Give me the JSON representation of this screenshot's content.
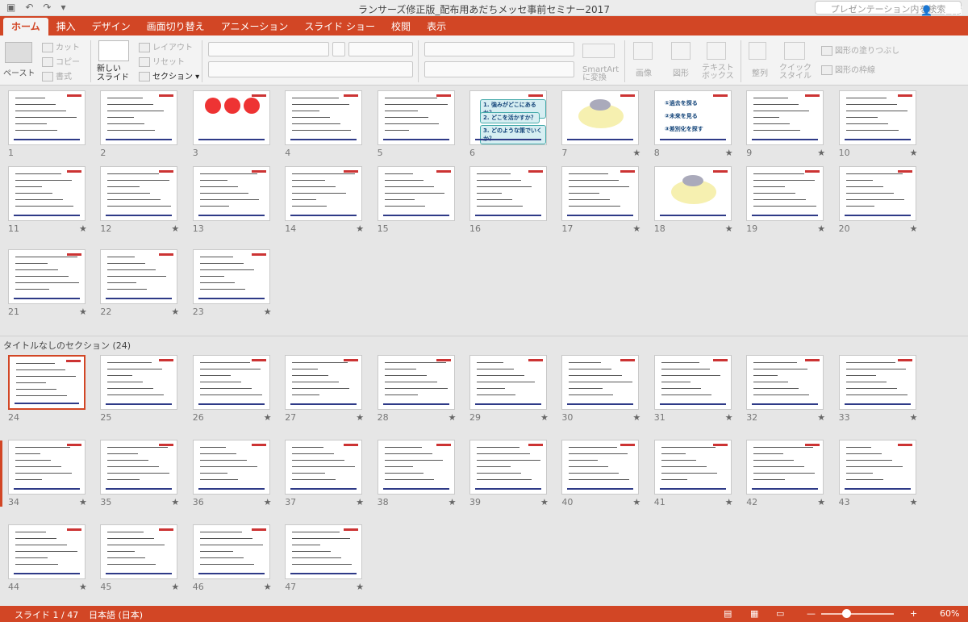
{
  "window": {
    "title": "ランサーズ修正版_配布用あだちメッセ事前セミナー2017",
    "search_placeholder": "プレゼンテーション内を検索"
  },
  "tabs": [
    "ホーム",
    "挿入",
    "デザイン",
    "画面切り替え",
    "アニメーション",
    "スライド ショー",
    "校閲",
    "表示"
  ],
  "share_label": "共有",
  "ribbon": {
    "paste": "ペースト",
    "cut": "カット",
    "copy": "コピー",
    "format": "書式",
    "new_slide": "新しい\nスライド",
    "layout": "レイアウト",
    "reset": "リセット",
    "section": "セクション",
    "smartart": "SmartArt\nに変換",
    "picture": "画像",
    "shape": "図形",
    "textbox": "テキスト\nボックス",
    "arrange": "整列",
    "quickstyle": "クイック\nスタイル",
    "shape_fill": "図形の塗りつぶし",
    "shape_outline": "図形の枠線"
  },
  "slides_row_numbers": [
    [
      1,
      2,
      3,
      4,
      5,
      6,
      7,
      8,
      9,
      10
    ],
    [
      11,
      12,
      13,
      14,
      15,
      16,
      17,
      18,
      19,
      20
    ],
    [
      21,
      22,
      23
    ],
    [
      24,
      25,
      26,
      27,
      28,
      29,
      30,
      31,
      32,
      33
    ],
    [
      34,
      35,
      36,
      37,
      38,
      39,
      40,
      41,
      42,
      43
    ],
    [
      44,
      45,
      46,
      47
    ]
  ],
  "slide6_lines": [
    "1. 強みがどこにあるか？",
    "2. どこを活かすか？",
    "3. どのような策でいくか？"
  ],
  "slide8_lines": [
    "①過去を探る",
    "②未来を見る",
    "③差別化を探す"
  ],
  "section_header": "タイトルなしのセクション (24)",
  "status": {
    "slide_indicator": "スライド 1 / 47",
    "language": "日本語 (日本)",
    "zoom": "60%"
  }
}
